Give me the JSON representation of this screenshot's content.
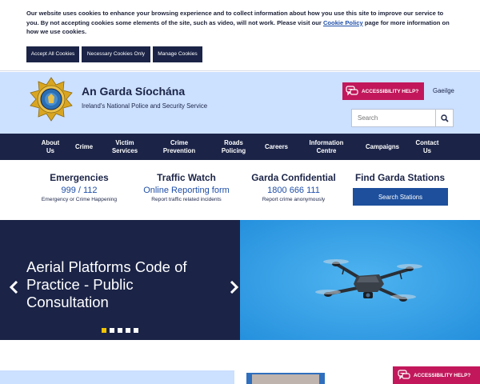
{
  "cookie": {
    "text_before": "Our website uses cookies to enhance your browsing experience and to collect information about how you use this site to improve our service to you. By not accepting cookies some elements of the site, such as video, will not work. Please visit our ",
    "policy_link": "Cookie Policy",
    "text_after": " page for more information on how we use cookies.",
    "buttons": [
      "Accept All Cookies",
      "Necessary Cookies Only",
      "Manage Cookies"
    ]
  },
  "header": {
    "title": "An Garda Síochána",
    "subtitle": "Ireland's National Police and Security Service",
    "accessibility_label": "ACCESSIBILITY HELP?",
    "language_link": "Gaeilge",
    "search_placeholder": "Search",
    "crest_icon": "garda-crest-icon"
  },
  "nav": {
    "items": [
      {
        "label": "About Us",
        "line1": "About",
        "line2": "Us"
      },
      {
        "label": "Crime",
        "line1": "Crime",
        "line2": ""
      },
      {
        "label": "Victim Services",
        "line1": "Victim",
        "line2": "Services"
      },
      {
        "label": "Crime Prevention",
        "line1": "Crime",
        "line2": "Prevention"
      },
      {
        "label": "Roads Policing",
        "line1": "Roads",
        "line2": "Policing"
      },
      {
        "label": "Careers",
        "line1": "Careers",
        "line2": ""
      },
      {
        "label": "Information Centre",
        "line1": "Information",
        "line2": "Centre"
      },
      {
        "label": "Campaigns",
        "line1": "Campaigns",
        "line2": ""
      },
      {
        "label": "Contact Us",
        "line1": "Contact",
        "line2": "Us"
      }
    ]
  },
  "quick_links": [
    {
      "title": "Emergencies",
      "link": "999 / 112",
      "desc": "Emergency or Crime Happening"
    },
    {
      "title": "Traffic Watch",
      "link": "Online Reporting form",
      "desc": "Report traffic related incidents"
    },
    {
      "title": "Garda Confidential",
      "link": "1800 666 111",
      "desc": "Report crime anonymously"
    },
    {
      "title": "Find Garda Stations",
      "button": "Search Stations"
    }
  ],
  "hero": {
    "title": "Aerial Platforms Code of Practice - Public Consultation",
    "prev_icon": "chevron-left-icon",
    "next_icon": "chevron-right-icon",
    "slide_count": 5,
    "active_slide": 1
  },
  "colors": {
    "navy": "#1b2447",
    "header_bg": "#cce0ff",
    "accessibility_pink": "#c2185b",
    "link_blue": "#1f4fa8",
    "button_blue": "#1d4f9c",
    "sky_blue": "#36a3ea",
    "active_dot": "#f2c400"
  },
  "floating": {
    "accessibility_label": "ACCESSIBILITY HELP?"
  }
}
